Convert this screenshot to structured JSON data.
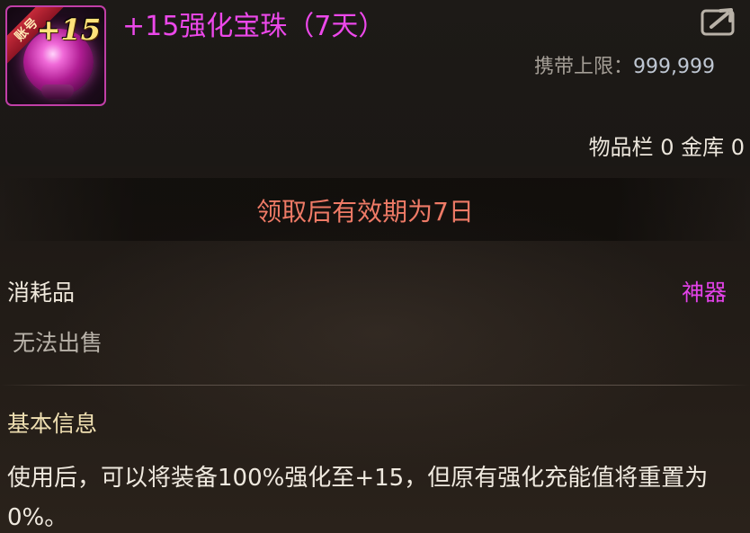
{
  "item": {
    "badge_label": "账号",
    "enhance_label": "+15",
    "name": "+15强化宝珠（7天）",
    "rarity_color": "#ec48ea",
    "icon": "pink-orb-icon"
  },
  "header": {
    "carry_limit_label": "携带上限：",
    "carry_limit_value": "999,999",
    "storage_label": "物品栏 0 金库 0",
    "export_icon": "share-export-icon"
  },
  "validity": {
    "text": "领取后有效期为7日"
  },
  "info": {
    "category": "消耗品",
    "grade": "神器",
    "sale_status": "无法出售"
  },
  "basic": {
    "title": "基本信息",
    "description": "使用后，可以将装备100%强化至+15，但原有强化充能值将重置为0%。"
  }
}
